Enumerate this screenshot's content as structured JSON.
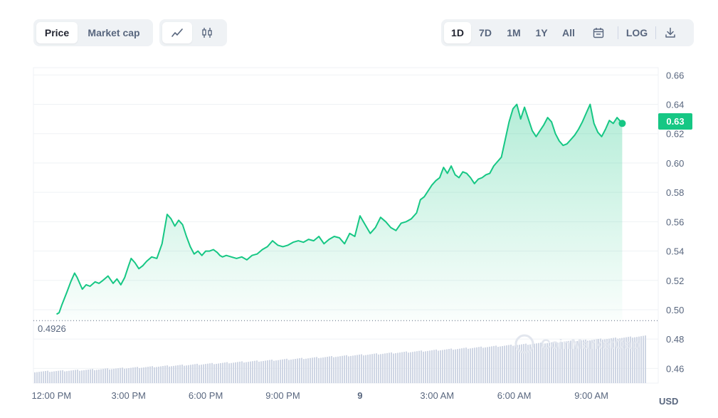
{
  "toolbar": {
    "metric_tabs": [
      "Price",
      "Market cap"
    ],
    "active_metric": "Price",
    "chart_type_icons": [
      "line-chart-icon",
      "candlestick-icon"
    ],
    "active_chart_type": "line-chart-icon",
    "range_tabs": [
      "1D",
      "7D",
      "1M",
      "1Y",
      "All"
    ],
    "active_range": "1D",
    "calendar_icon": "calendar-icon",
    "log_label": "LOG",
    "download_icon": "download-icon"
  },
  "watermark": "CoinMarketCap",
  "currency_label": "USD",
  "colors": {
    "line": "#16c784",
    "fill_top": "#16c784",
    "volume": "#cfd6e4",
    "badge": "#16c784",
    "text": "#58667e"
  },
  "chart_data": {
    "type": "area",
    "title": "",
    "xlabel": "",
    "ylabel": "",
    "ylim": [
      0.45,
      0.665
    ],
    "x_range_hours": [
      11.3,
      35.6
    ],
    "yticks": [
      0.46,
      0.48,
      0.5,
      0.52,
      0.54,
      0.56,
      0.58,
      0.6,
      0.62,
      0.64,
      0.66
    ],
    "ytick_labels": [
      "0.46",
      "0.48",
      "0.50",
      "0.52",
      "0.54",
      "0.56",
      "0.58",
      "0.60",
      "0.62",
      "0.64",
      "0.66"
    ],
    "xticks": [
      12,
      15,
      18,
      21,
      24,
      27,
      30,
      33
    ],
    "xtick_labels": [
      "12:00 PM",
      "3:00 PM",
      "6:00 PM",
      "9:00 PM",
      "9",
      "3:00 AM",
      "6:00 AM",
      "9:00 AM"
    ],
    "reference_price": 0.4926,
    "reference_label": "0.4926",
    "current_price_label": "0.63",
    "grid": true,
    "series": [
      {
        "x": [
          12.2,
          12.3,
          12.4,
          12.6,
          12.75,
          12.9,
          13.0,
          13.1,
          13.2,
          13.35,
          13.5,
          13.7,
          13.85,
          14.0,
          14.2,
          14.4,
          14.55,
          14.7,
          14.85,
          15.0,
          15.1,
          15.25,
          15.4,
          15.55,
          15.7,
          15.9,
          16.1,
          16.3,
          16.5,
          16.65,
          16.8,
          16.95,
          17.1,
          17.25,
          17.4,
          17.55,
          17.7,
          17.85,
          18.0,
          18.15,
          18.3,
          18.45,
          18.55,
          18.65,
          18.8,
          19.0,
          19.2,
          19.4,
          19.6,
          19.8,
          20.0,
          20.2,
          20.4,
          20.6,
          20.8,
          21.0,
          21.2,
          21.4,
          21.6,
          21.8,
          22.0,
          22.2,
          22.4,
          22.6,
          22.8,
          23.0,
          23.2,
          23.4,
          23.6,
          23.8,
          24.0,
          24.2,
          24.4,
          24.6,
          24.8,
          25.0,
          25.2,
          25.4,
          25.6,
          25.8,
          26.0,
          26.2,
          26.35,
          26.5,
          26.65,
          26.8,
          26.95,
          27.1,
          27.25,
          27.4,
          27.55,
          27.7,
          27.85,
          28.0,
          28.15,
          28.3,
          28.45,
          28.6,
          28.75,
          28.9,
          29.05,
          29.2,
          29.35,
          29.5,
          29.65,
          29.8,
          29.95,
          30.1,
          30.25,
          30.4,
          30.55,
          30.7,
          30.85,
          31.0,
          31.15,
          31.3,
          31.45,
          31.6,
          31.75,
          31.9,
          32.05,
          32.2,
          32.35,
          32.5,
          32.65,
          32.8,
          32.95,
          33.1,
          33.25,
          33.4,
          33.55,
          33.7,
          33.85,
          34.0,
          34.1,
          34.2
        ],
        "y": [
          0.497,
          0.498,
          0.503,
          0.512,
          0.519,
          0.525,
          0.522,
          0.518,
          0.514,
          0.517,
          0.516,
          0.519,
          0.518,
          0.52,
          0.523,
          0.518,
          0.521,
          0.517,
          0.522,
          0.53,
          0.535,
          0.532,
          0.528,
          0.53,
          0.533,
          0.536,
          0.535,
          0.545,
          0.565,
          0.562,
          0.557,
          0.561,
          0.558,
          0.55,
          0.543,
          0.538,
          0.54,
          0.537,
          0.54,
          0.54,
          0.541,
          0.539,
          0.537,
          0.536,
          0.537,
          0.536,
          0.535,
          0.536,
          0.534,
          0.537,
          0.538,
          0.541,
          0.543,
          0.547,
          0.544,
          0.543,
          0.544,
          0.546,
          0.547,
          0.546,
          0.548,
          0.547,
          0.55,
          0.545,
          0.548,
          0.55,
          0.549,
          0.545,
          0.552,
          0.55,
          0.564,
          0.558,
          0.552,
          0.556,
          0.563,
          0.56,
          0.556,
          0.554,
          0.559,
          0.56,
          0.562,
          0.566,
          0.575,
          0.577,
          0.581,
          0.585,
          0.588,
          0.59,
          0.597,
          0.593,
          0.598,
          0.592,
          0.59,
          0.594,
          0.593,
          0.59,
          0.586,
          0.589,
          0.59,
          0.592,
          0.593,
          0.598,
          0.601,
          0.604,
          0.616,
          0.628,
          0.637,
          0.64,
          0.63,
          0.638,
          0.63,
          0.622,
          0.618,
          0.622,
          0.626,
          0.631,
          0.628,
          0.62,
          0.615,
          0.612,
          0.613,
          0.616,
          0.619,
          0.623,
          0.628,
          0.634,
          0.64,
          0.627,
          0.621,
          0.618,
          0.623,
          0.629,
          0.627,
          0.631,
          0.629,
          0.627
        ]
      }
    ]
  }
}
